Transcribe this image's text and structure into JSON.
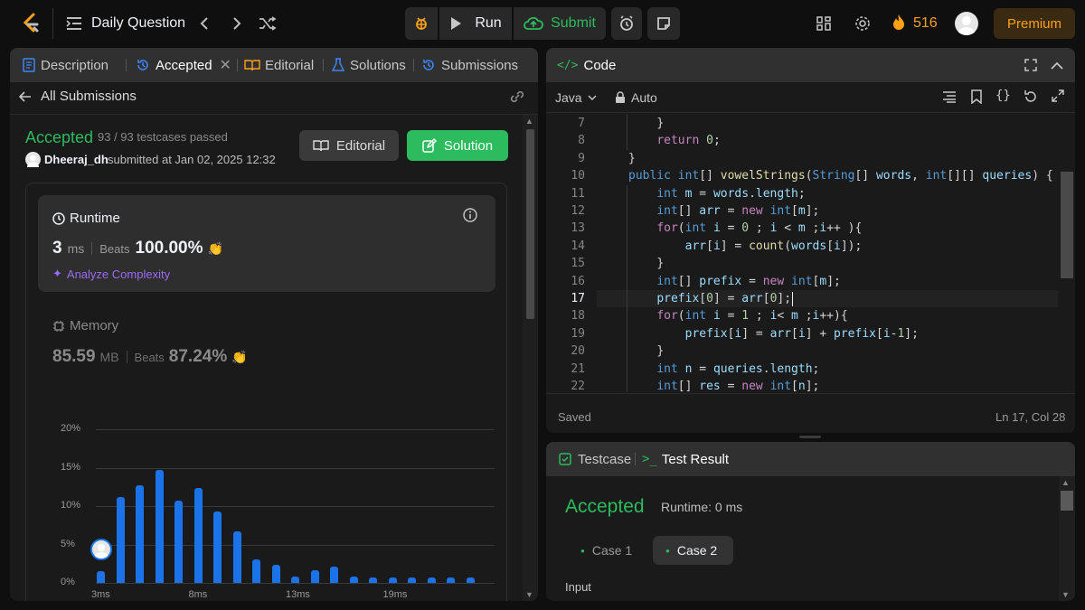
{
  "topbar": {
    "title": "Daily Question",
    "run_label": "Run",
    "submit_label": "Submit",
    "streak_count": "516",
    "premium_label": "Premium"
  },
  "left_tabs": [
    {
      "label": "Description"
    },
    {
      "label": "Accepted"
    },
    {
      "label": "Editorial"
    },
    {
      "label": "Solutions"
    },
    {
      "label": "Submissions"
    }
  ],
  "submission": {
    "back_label": "All Submissions",
    "status": "Accepted",
    "testcases": "93 / 93 testcases passed",
    "user": "Dheeraj_dh",
    "submitted_text": "submitted at Jan 02, 2025 12:32",
    "editorial_btn": "Editorial",
    "solution_btn": "Solution"
  },
  "runtime": {
    "heading": "Runtime",
    "value": "3",
    "unit": "ms",
    "beats_label": "Beats",
    "beats_value": "100.00%",
    "analyze_label": "Analyze Complexity"
  },
  "memory": {
    "heading": "Memory",
    "value": "85.59",
    "unit": "MB",
    "beats_label": "Beats",
    "beats_value": "87.24%"
  },
  "chart_data": {
    "type": "bar",
    "y_tick_labels": [
      "20%",
      "15%",
      "10%",
      "5%",
      "0%"
    ],
    "ylim": [
      0,
      20
    ],
    "x_tick_labels": [
      "3ms",
      "8ms",
      "13ms",
      "19ms"
    ],
    "values": [
      1.5,
      11.2,
      12.7,
      14.7,
      10.7,
      12.4,
      9.3,
      6.7,
      3.1,
      2.4,
      0.8,
      1.6,
      2.1,
      0.8,
      0.7,
      0.7,
      0.7,
      0.7,
      0.7,
      0.7
    ],
    "marker_bar_index": 0,
    "bar_color": "#1a73e8"
  },
  "code_panel": {
    "title": "Code",
    "language": "Java",
    "mode": "Auto",
    "status_left": "Saved",
    "status_right": "Ln 17, Col 28",
    "lines": [
      {
        "n": "7",
        "ind": 4,
        "tokens": [
          [
            "tx",
            "}"
          ]
        ]
      },
      {
        "n": "8",
        "ind": 4,
        "tokens": [
          [
            "kw",
            "return"
          ],
          [
            "tx",
            " "
          ],
          [
            "nm",
            "0"
          ],
          [
            "tx",
            ";"
          ]
        ]
      },
      {
        "n": "9",
        "ind": 0,
        "tokens": [
          [
            "tx",
            "}"
          ]
        ]
      },
      {
        "n": "10",
        "ind": 0,
        "tokens": [
          [
            "ty",
            "public"
          ],
          [
            "tx",
            " "
          ],
          [
            "ty",
            "int"
          ],
          [
            "tx",
            "[] "
          ],
          [
            "fn",
            "vowelStrings"
          ],
          [
            "tx",
            "("
          ],
          [
            "ty",
            "String"
          ],
          [
            "tx",
            "[] "
          ],
          [
            "va",
            "words"
          ],
          [
            "tx",
            ", "
          ],
          [
            "ty",
            "int"
          ],
          [
            "tx",
            "[][] "
          ],
          [
            "va",
            "queries"
          ],
          [
            "tx",
            ") {"
          ]
        ]
      },
      {
        "n": "11",
        "ind": 4,
        "tokens": [
          [
            "ty",
            "int"
          ],
          [
            "tx",
            " "
          ],
          [
            "va",
            "m"
          ],
          [
            "tx",
            " = "
          ],
          [
            "va",
            "words"
          ],
          [
            "tx",
            "."
          ],
          [
            "va",
            "length"
          ],
          [
            "tx",
            ";"
          ]
        ]
      },
      {
        "n": "12",
        "ind": 4,
        "tokens": [
          [
            "ty",
            "int"
          ],
          [
            "tx",
            "[] "
          ],
          [
            "va",
            "arr"
          ],
          [
            "tx",
            " = "
          ],
          [
            "kw",
            "new"
          ],
          [
            "tx",
            " "
          ],
          [
            "ty",
            "int"
          ],
          [
            "tx",
            "["
          ],
          [
            "va",
            "m"
          ],
          [
            "tx",
            "];"
          ]
        ]
      },
      {
        "n": "13",
        "ind": 4,
        "tokens": [
          [
            "kw",
            "for"
          ],
          [
            "tx",
            "("
          ],
          [
            "ty",
            "int"
          ],
          [
            "tx",
            " "
          ],
          [
            "va",
            "i"
          ],
          [
            "tx",
            " = "
          ],
          [
            "nm",
            "0"
          ],
          [
            "tx",
            " ; "
          ],
          [
            "va",
            "i"
          ],
          [
            "tx",
            " < "
          ],
          [
            "va",
            "m"
          ],
          [
            "tx",
            " ;"
          ],
          [
            "va",
            "i"
          ],
          [
            "tx",
            "++ ){"
          ]
        ]
      },
      {
        "n": "14",
        "ind": 8,
        "tokens": [
          [
            "va",
            "arr"
          ],
          [
            "tx",
            "["
          ],
          [
            "va",
            "i"
          ],
          [
            "tx",
            "] = "
          ],
          [
            "fn",
            "count"
          ],
          [
            "tx",
            "("
          ],
          [
            "va",
            "words"
          ],
          [
            "tx",
            "["
          ],
          [
            "va",
            "i"
          ],
          [
            "tx",
            "]);"
          ]
        ]
      },
      {
        "n": "15",
        "ind": 4,
        "tokens": [
          [
            "tx",
            "}"
          ]
        ]
      },
      {
        "n": "16",
        "ind": 4,
        "tokens": [
          [
            "ty",
            "int"
          ],
          [
            "tx",
            "[] "
          ],
          [
            "va",
            "prefix"
          ],
          [
            "tx",
            " = "
          ],
          [
            "kw",
            "new"
          ],
          [
            "tx",
            " "
          ],
          [
            "ty",
            "int"
          ],
          [
            "tx",
            "["
          ],
          [
            "va",
            "m"
          ],
          [
            "tx",
            "];"
          ]
        ]
      },
      {
        "n": "17",
        "ind": 4,
        "tokens": [
          [
            "va",
            "prefix"
          ],
          [
            "tx",
            "["
          ],
          [
            "nm",
            "0"
          ],
          [
            "tx",
            "] = "
          ],
          [
            "va",
            "arr"
          ],
          [
            "tx",
            "["
          ],
          [
            "nm",
            "0"
          ],
          [
            "tx",
            "];"
          ]
        ]
      },
      {
        "n": "18",
        "ind": 4,
        "tokens": [
          [
            "kw",
            "for"
          ],
          [
            "tx",
            "("
          ],
          [
            "ty",
            "int"
          ],
          [
            "tx",
            " "
          ],
          [
            "va",
            "i"
          ],
          [
            "tx",
            " = "
          ],
          [
            "nm",
            "1"
          ],
          [
            "tx",
            " ; "
          ],
          [
            "va",
            "i"
          ],
          [
            "tx",
            "< "
          ],
          [
            "va",
            "m"
          ],
          [
            "tx",
            " ;"
          ],
          [
            "va",
            "i"
          ],
          [
            "tx",
            "++){"
          ]
        ]
      },
      {
        "n": "19",
        "ind": 8,
        "tokens": [
          [
            "va",
            "prefix"
          ],
          [
            "tx",
            "["
          ],
          [
            "va",
            "i"
          ],
          [
            "tx",
            "] = "
          ],
          [
            "va",
            "arr"
          ],
          [
            "tx",
            "["
          ],
          [
            "va",
            "i"
          ],
          [
            "tx",
            "] + "
          ],
          [
            "va",
            "prefix"
          ],
          [
            "tx",
            "["
          ],
          [
            "va",
            "i"
          ],
          [
            "tx",
            "-"
          ],
          [
            "nm",
            "1"
          ],
          [
            "tx",
            "];"
          ]
        ]
      },
      {
        "n": "20",
        "ind": 4,
        "tokens": [
          [
            "tx",
            "}"
          ]
        ]
      },
      {
        "n": "21",
        "ind": 4,
        "tokens": [
          [
            "ty",
            "int"
          ],
          [
            "tx",
            " "
          ],
          [
            "va",
            "n"
          ],
          [
            "tx",
            " = "
          ],
          [
            "va",
            "queries"
          ],
          [
            "tx",
            "."
          ],
          [
            "va",
            "length"
          ],
          [
            "tx",
            ";"
          ]
        ]
      },
      {
        "n": "22",
        "ind": 4,
        "tokens": [
          [
            "ty",
            "int"
          ],
          [
            "tx",
            "[] "
          ],
          [
            "va",
            "res"
          ],
          [
            "tx",
            " = "
          ],
          [
            "kw",
            "new"
          ],
          [
            "tx",
            " "
          ],
          [
            "ty",
            "int"
          ],
          [
            "tx",
            "["
          ],
          [
            "va",
            "n"
          ],
          [
            "tx",
            "];"
          ]
        ]
      }
    ]
  },
  "test_panel": {
    "tab_testcase": "Testcase",
    "tab_result": "Test Result",
    "status": "Accepted",
    "runtime_text": "Runtime: 0 ms",
    "case1": "Case 1",
    "case2": "Case 2",
    "input_label": "Input"
  }
}
